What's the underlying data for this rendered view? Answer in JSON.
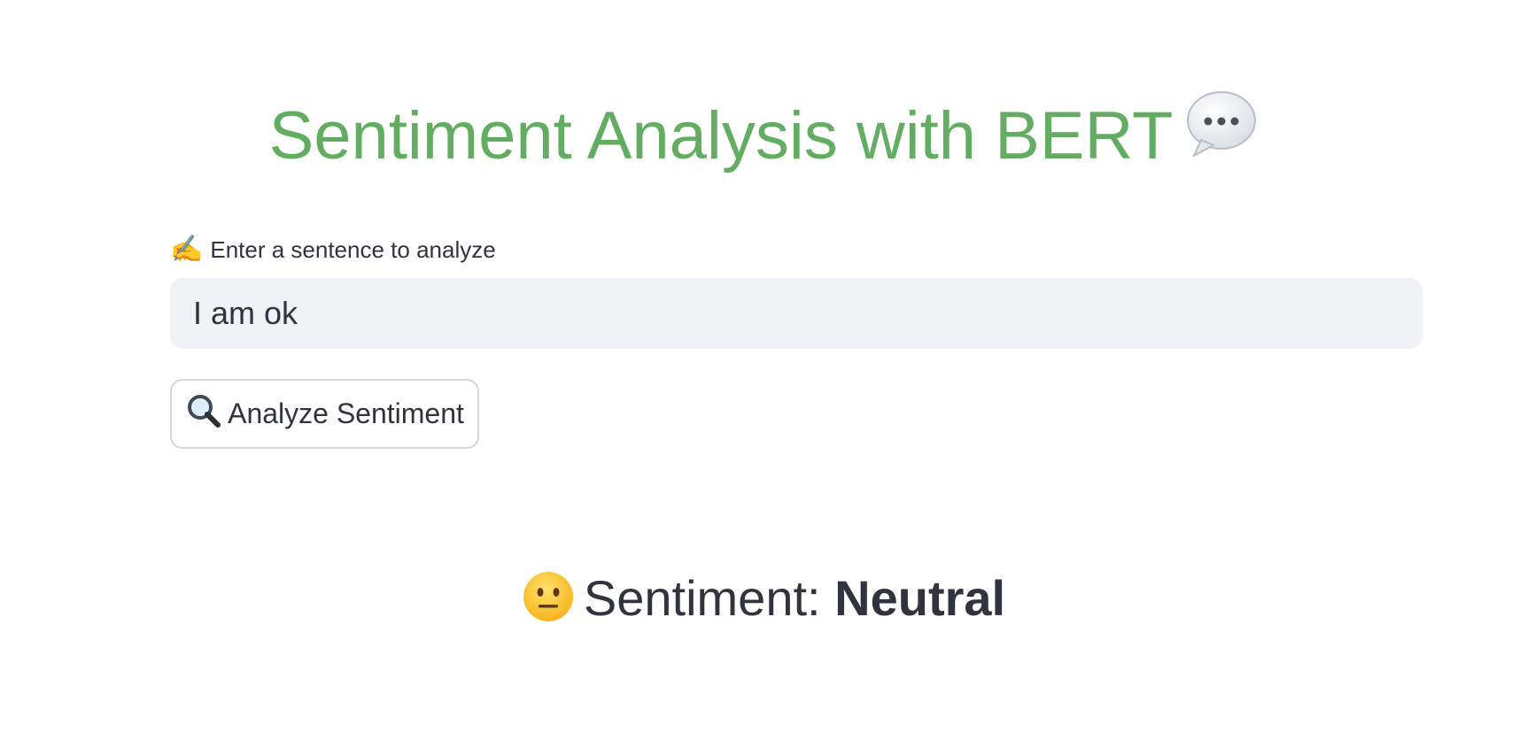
{
  "header": {
    "title": "Sentiment Analysis with BERT",
    "title_icon": "speech-bubble-icon",
    "title_color": "#62ad61"
  },
  "input": {
    "label_icon": "writing-hand-icon",
    "label_icon_glyph": "✍️",
    "label": "Enter a sentence to analyze",
    "value": "I am ok",
    "background": "#f0f2f6"
  },
  "button": {
    "icon": "magnifying-glass-icon",
    "label": "Analyze Sentiment"
  },
  "result": {
    "icon": "neutral-face-icon",
    "prefix": "Sentiment:",
    "value": "Neutral"
  }
}
